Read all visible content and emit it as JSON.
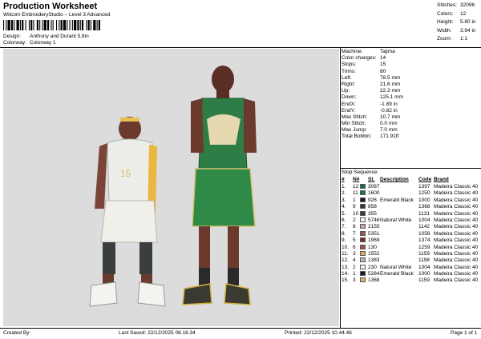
{
  "header": {
    "title": "Production Worksheet",
    "subtitle": "Wilcom EmbroideryStudio – Level 3 Advanced",
    "design_label": "Design:",
    "design_value": "Anthony and Durant 5,8in",
    "colorway_label": "Colorway:",
    "colorway_value": "Colorway 1"
  },
  "summary": [
    {
      "label": "Stitches:",
      "value": "32096"
    },
    {
      "label": "Colors:",
      "value": "12"
    },
    {
      "label": "Height:",
      "value": "5.80 in"
    },
    {
      "label": "Width:",
      "value": "3.94 in"
    },
    {
      "label": "Zoom:",
      "value": "1:1"
    }
  ],
  "machine_stats": [
    {
      "label": "Machine:",
      "value": "Tajima"
    },
    {
      "label": "Color changes:",
      "value": "14"
    },
    {
      "label": "Stops:",
      "value": "15"
    },
    {
      "label": "Trims:",
      "value": "80"
    },
    {
      "label": "Left:",
      "value": "78.5 mm"
    },
    {
      "label": "Right:",
      "value": "21.6 mm"
    },
    {
      "label": "Up:",
      "value": "22.3 mm"
    },
    {
      "label": "Down:",
      "value": "125.1 mm"
    },
    {
      "label": "EndX:",
      "value": "-1.89 in"
    },
    {
      "label": "EndY:",
      "value": "-0.82 in"
    },
    {
      "label": "Max Stitch:",
      "value": "10.7 mm"
    },
    {
      "label": "Min Stitch:",
      "value": "0.0 mm"
    },
    {
      "label": "Max Jump:",
      "value": "7.0 mm"
    },
    {
      "label": "Total Bobbin:",
      "value": "171.91ft"
    }
  ],
  "stop_sequence": {
    "title": "Stop Sequence:",
    "headers": {
      "idx": "#",
      "no": "N#",
      "st": "St.",
      "description": "Description",
      "code": "Code",
      "brand": "Brand"
    },
    "rows": [
      {
        "idx": "1.",
        "no": "12",
        "color": "#1d6b4a",
        "st": "3087",
        "description": "",
        "code": "1397",
        "brand": "Madeira Classic 40"
      },
      {
        "idx": "2.",
        "no": "11",
        "color": "#1e7a3c",
        "st": "1600",
        "description": "",
        "code": "1250",
        "brand": "Madeira Classic 40"
      },
      {
        "idx": "3.",
        "no": "1",
        "color": "#1a1a1a",
        "st": "926",
        "description": "Emerald Black",
        "code": "1000",
        "brand": "Madeira Classic 40"
      },
      {
        "idx": "4.",
        "no": "9",
        "color": "#2e3a3c",
        "st": "858",
        "description": "",
        "code": "1368",
        "brand": "Madeira Classic 40"
      },
      {
        "idx": "5.",
        "no": "10",
        "color": "#3a3a3a",
        "st": "355",
        "description": "",
        "code": "1131",
        "brand": "Madeira Classic 40"
      },
      {
        "idx": "6.",
        "no": "2",
        "color": "#f5f5f0",
        "st": "5746",
        "description": "Natural White",
        "code": "1004",
        "brand": "Madeira Classic 40"
      },
      {
        "idx": "7.",
        "no": "8",
        "color": "#c9a2a8",
        "st": "2155",
        "description": "",
        "code": "1142",
        "brand": "Madeira Classic 40"
      },
      {
        "idx": "8.",
        "no": "7",
        "color": "#9a5a4a",
        "st": "5351",
        "description": "",
        "code": "1056",
        "brand": "Madeira Classic 40"
      },
      {
        "idx": "9.",
        "no": "5",
        "color": "#7a2a2a",
        "st": "1969",
        "description": "",
        "code": "1374",
        "brand": "Madeira Classic 40"
      },
      {
        "idx": "10.",
        "no": "6",
        "color": "#a0504a",
        "st": "130",
        "description": "",
        "code": "1259",
        "brand": "Madeira Classic 40"
      },
      {
        "idx": "11.",
        "no": "3",
        "color": "#e0b060",
        "st": "1552",
        "description": "",
        "code": "1159",
        "brand": "Madeira Classic 40"
      },
      {
        "idx": "12.",
        "no": "4",
        "color": "#b8b8b0",
        "st": "1383",
        "description": "",
        "code": "1198",
        "brand": "Madeira Classic 40"
      },
      {
        "idx": "13.",
        "no": "2",
        "color": "#f5f5f0",
        "st": "230",
        "description": "Natural White",
        "code": "1004",
        "brand": "Madeira Classic 40"
      },
      {
        "idx": "14.",
        "no": "1",
        "color": "#1a1a1a",
        "st": "5284",
        "description": "Emerald Black",
        "code": "1000",
        "brand": "Madeira Classic 40"
      },
      {
        "idx": "15.",
        "no": "3",
        "color": "#e0b060",
        "st": "1368",
        "description": "",
        "code": "1159",
        "brand": "Madeira Classic 40"
      }
    ]
  },
  "footer": {
    "created_by": "Created By:",
    "last_saved": "Last Saved: 22/12/2025 08.18.34",
    "printed": "Printed: 22/12/2025 10.44.46",
    "page": "Page 1 of 1"
  }
}
